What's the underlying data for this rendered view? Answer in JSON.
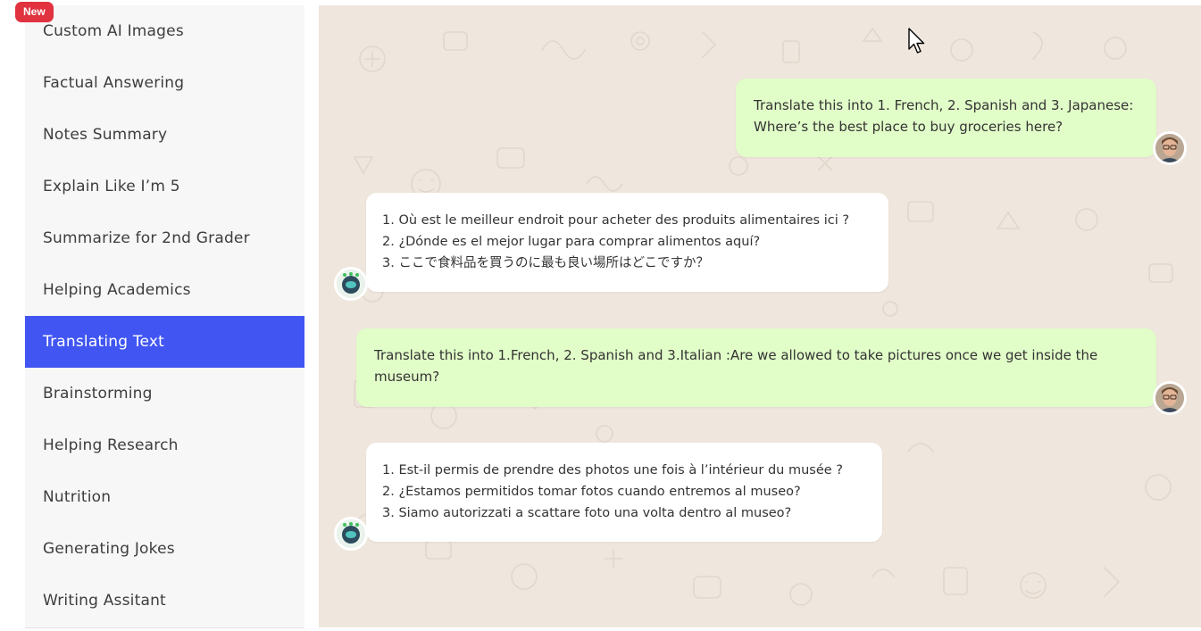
{
  "sidebar": {
    "badge": "New",
    "items": [
      {
        "label": "Custom AI Images"
      },
      {
        "label": "Factual Answering"
      },
      {
        "label": "Notes Summary"
      },
      {
        "label": "Explain Like I’m 5"
      },
      {
        "label": "Summarize for 2nd Grader"
      },
      {
        "label": "Helping Academics"
      },
      {
        "label": "Translating Text",
        "active": true
      },
      {
        "label": "Brainstorming"
      },
      {
        "label": "Helping Research"
      },
      {
        "label": "Nutrition"
      },
      {
        "label": "Generating Jokes"
      },
      {
        "label": "Writing Assitant"
      }
    ]
  },
  "chat": {
    "messages": [
      {
        "role": "user",
        "lines": [
          "Translate this into 1. French, 2. Spanish and 3. Japanese:",
          "Where’s the best place to buy groceries here?"
        ]
      },
      {
        "role": "bot",
        "lines": [
          "1. Où est le meilleur endroit pour acheter des produits alimentaires ici ?",
          "2. ¿Dónde es el mejor lugar para comprar alimentos aquí?",
          "3. ここで食料品を買うのに最も良い場所はどこですか？"
        ]
      },
      {
        "role": "user",
        "text": "Translate this into 1.French, 2. Spanish and 3.Italian :Are we allowed to take pictures once we get inside the museum?"
      },
      {
        "role": "bot",
        "lines": [
          "1. Est-il permis de prendre des photos une fois à l’intérieur du musée ?",
          "2. ¿Estamos permitidos tomar fotos cuando entremos al museo?",
          "3. Siamo autorizzati a scattare foto una volta dentro al museo?"
        ]
      }
    ]
  },
  "colors": {
    "accent": "#4055f2",
    "badge": "#e0323f",
    "user_bubble": "#e1fdc8",
    "chat_bg": "#efe6dd"
  }
}
